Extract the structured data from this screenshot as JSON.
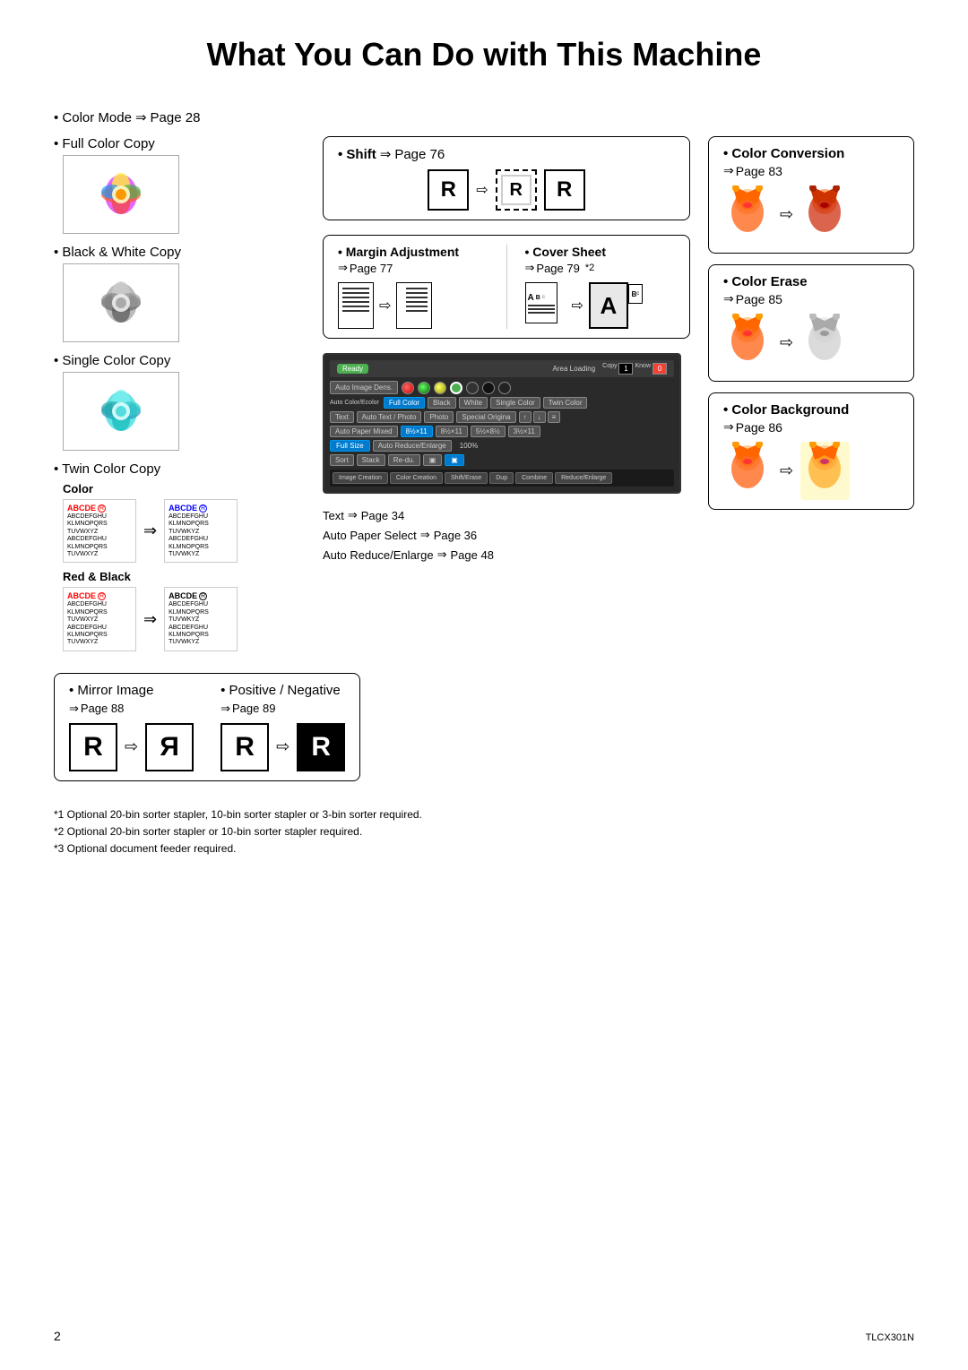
{
  "page": {
    "title": "What You Can Do with This Machine",
    "page_number": "2",
    "doc_code": "TLCX301N"
  },
  "left_column": {
    "color_mode": {
      "label": "• Color Mode",
      "arrow": "⇒",
      "page": "Page 28"
    },
    "full_color": {
      "label": "• Full Color Copy"
    },
    "bw_copy": {
      "label": "• Black & White Copy"
    },
    "single_color": {
      "label": "• Single Color Copy"
    },
    "twin_color": {
      "label": "• Twin Color Copy",
      "sub_color": "Color",
      "sub_red_black": "Red & Black"
    }
  },
  "center_column": {
    "shift": {
      "label": "• Shift",
      "arrow": "⇒",
      "page": "Page 76"
    },
    "margin": {
      "label": "• Margin Adjustment",
      "arrow": "⇒",
      "page": "Page 77"
    },
    "cover": {
      "label": "• Cover Sheet",
      "arrow": "⇒",
      "page": "Page 79",
      "note": "*2"
    },
    "text": {
      "label": "Text",
      "arrow": "⇒",
      "page": "Page 34"
    },
    "auto_paper": {
      "label": "Auto Paper Select",
      "arrow": "⇒",
      "page": "Page 36"
    },
    "auto_reduce": {
      "label": "Auto Reduce/Enlarge",
      "arrow": "⇒",
      "page": "Page 48"
    }
  },
  "right_column": {
    "color_conversion": {
      "label": "• Color Conversion",
      "arrow": "⇒",
      "page": "Page 83"
    },
    "color_erase": {
      "label": "• Color Erase",
      "arrow": "⇒",
      "page": "Page 85"
    },
    "color_background": {
      "label": "• Color Background",
      "arrow": "⇒",
      "page": "Page 86"
    }
  },
  "bottom_left": {
    "mirror": {
      "label": "• Mirror Image",
      "arrow": "⇒",
      "page": "Page 88"
    },
    "positive": {
      "label": "• Positive / Negative",
      "arrow": "⇒",
      "page": "Page 89"
    }
  },
  "footnotes": {
    "note1": "*1 Optional 20-bin sorter stapler, 10-bin sorter stapler or 3-bin sorter required.",
    "note2": "*2 Optional 20-bin sorter stapler or 10-bin sorter stapler required.",
    "note3": "*3 Optional document feeder required."
  },
  "ui_panel": {
    "title": "Ready",
    "area_loading": "Area Loading",
    "copy": "Copy",
    "know": "Know",
    "auto_image": "Auto Image Dens.",
    "buttons": {
      "full_color": "Full Color",
      "black": "Black",
      "white": "White",
      "single_color": "Single Color",
      "twin_color": "Twin Color",
      "text": "Text",
      "auto_photo": "Auto Text / Photo",
      "photo": "Photo",
      "special_origina": "Special Origina",
      "auto_paper_mixed": "Auto Paper Mixed",
      "full_size": "Full Size",
      "auto_reduce_enlarge": "Auto Reduce/Enlarge",
      "sort": "Sort",
      "stack": "Stack",
      "reduce": "Reduce",
      "image_creation": "Image Creation",
      "color_creation": "Color Creation",
      "shift_erase": "Shift/Erase",
      "dup": "Dup",
      "combine": "Combine",
      "reduce_enlarge": "Reduce/Enlarge"
    },
    "value_100": "100%",
    "paper_sizes": {
      "size1": "8½×11",
      "size2": "8½×11",
      "size3": "5½×8½",
      "size4": "3½×11"
    }
  }
}
